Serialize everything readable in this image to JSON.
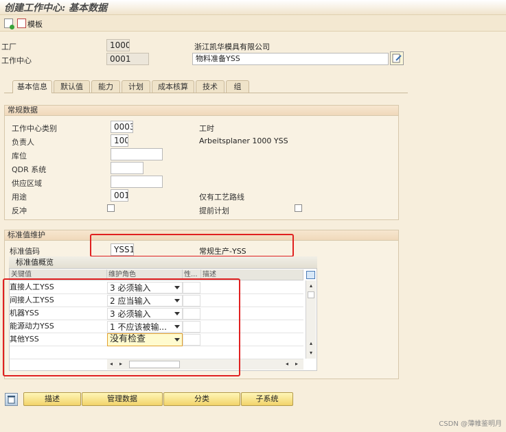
{
  "window": {
    "title": "创建工作中心: 基本数据"
  },
  "toolbar": {
    "template_label": "模板"
  },
  "header_fields": {
    "plant_label": "工厂",
    "plant_value": "1000",
    "plant_desc": "浙江凯华模具有限公司",
    "workcenter_label": "工作中心",
    "workcenter_value": "0001",
    "workcenter_desc": "物料准备YSS"
  },
  "tabs": [
    {
      "label": "基本信息",
      "active": true
    },
    {
      "label": "默认值",
      "active": false
    },
    {
      "label": "能力",
      "active": false
    },
    {
      "label": "计划",
      "active": false
    },
    {
      "label": "成本核算",
      "active": false
    },
    {
      "label": "技术",
      "active": false
    },
    {
      "label": "组",
      "active": false
    }
  ],
  "general_data": {
    "header": "常规数据",
    "wc_category_label": "工作中心类别",
    "wc_category_value": "0003",
    "work_time_label": "工时",
    "responsible_label": "负责人",
    "responsible_value": "100",
    "responsible_desc": "Arbeitsplaner  1000  YSS",
    "storage_label": "库位",
    "storage_value": "",
    "qdr_label": "QDR 系统",
    "qdr_value": "",
    "supply_area_label": "供应区域",
    "supply_area_value": "",
    "usage_label": "用途",
    "usage_value": "001",
    "usage_desc": "仅有工艺路线",
    "backflush_label": "反冲",
    "advance_plan_label": "提前计划"
  },
  "standard_values": {
    "header": "标准值维护",
    "key_label": "标准值码",
    "key_value": "YSS1",
    "key_desc": "常规生产-YSS",
    "overview_title": "标准值概览",
    "columns": [
      "关键值",
      "维护角色",
      "性...",
      "描述"
    ],
    "rows": [
      {
        "name": "直接人工YSS",
        "role": "3 必须输入"
      },
      {
        "name": "间接人工YSS",
        "role": "2 应当输入"
      },
      {
        "name": "机器YSS",
        "role": "3 必须输入"
      },
      {
        "name": "能源动力YSS",
        "role": "1 不应该被输..."
      },
      {
        "name": "其他YSS",
        "role": "没有检查"
      }
    ]
  },
  "bottom_buttons": {
    "describe": "描述",
    "admin_data": "管理数据",
    "classify": "分类",
    "subsystem": "子系统"
  },
  "watermark": "CSDN @薄帷鉴明月",
  "colors": {
    "background": "#f7eedc",
    "highlight_red": "#e02020",
    "button_yellow": "#f2d36a"
  }
}
